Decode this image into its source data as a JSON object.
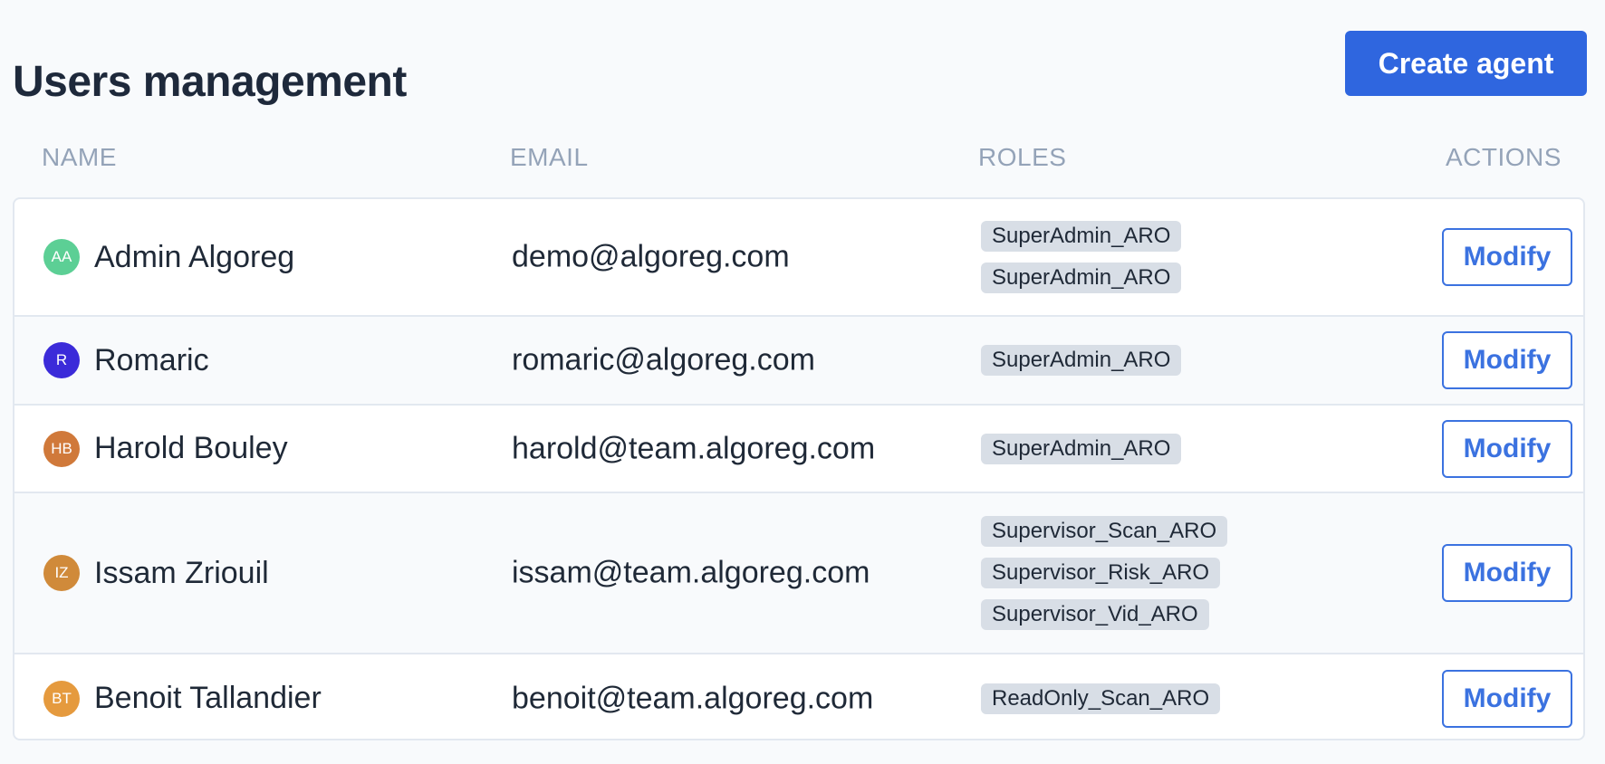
{
  "page": {
    "title": "Users management"
  },
  "toolbar": {
    "create_label": "Create agent",
    "accent_color": "#2f66df"
  },
  "table": {
    "columns": [
      "NAME",
      "EMAIL",
      "ROLES",
      "ACTIONS"
    ],
    "rows": [
      {
        "initials": "AA",
        "avatar_color": "#5ccf95",
        "name": "Admin Algoreg",
        "email": "demo@algoreg.com",
        "roles": [
          "SuperAdmin_ARO",
          "SuperAdmin_ARO"
        ],
        "action": "Modify"
      },
      {
        "initials": "R",
        "avatar_color": "#3b2bd9",
        "name": "Romaric",
        "email": "romaric@algoreg.com",
        "roles": [
          "SuperAdmin_ARO"
        ],
        "action": "Modify"
      },
      {
        "initials": "HB",
        "avatar_color": "#d0793a",
        "name": "Harold Bouley",
        "email": "harold@team.algoreg.com",
        "roles": [
          "SuperAdmin_ARO"
        ],
        "action": "Modify"
      },
      {
        "initials": "IZ",
        "avatar_color": "#d08a3a",
        "name": "Issam Zriouil",
        "email": "issam@team.algoreg.com",
        "roles": [
          "Supervisor_Scan_ARO",
          "Supervisor_Risk_ARO",
          "Supervisor_Vid_ARO"
        ],
        "action": "Modify"
      },
      {
        "initials": "BT",
        "avatar_color": "#e59a3e",
        "name": "Benoit Tallandier",
        "email": "benoit@team.algoreg.com",
        "roles": [
          "ReadOnly_Scan_ARO"
        ],
        "action": "Modify"
      }
    ]
  }
}
